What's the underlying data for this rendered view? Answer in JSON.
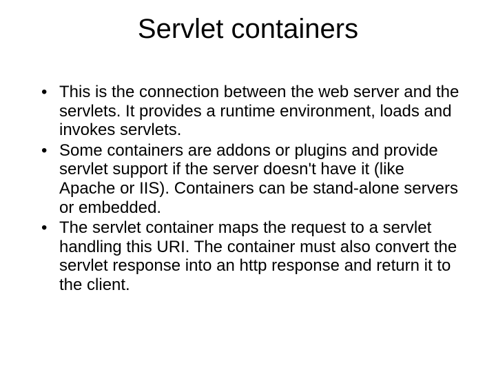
{
  "slide": {
    "title": "Servlet containers",
    "bullets": [
      "This is the connection between the web server and the servlets.  It provides a runtime environment, loads and invokes servlets.",
      "Some containers are addons or plugins and provide servlet support if the server doesn't have it (like Apache or IIS).  Containers can be stand-alone servers or embedded.",
      "The servlet container maps the request to a servlet handling this URI.  The container must also convert the servlet response into an http response and return it to the client."
    ]
  }
}
